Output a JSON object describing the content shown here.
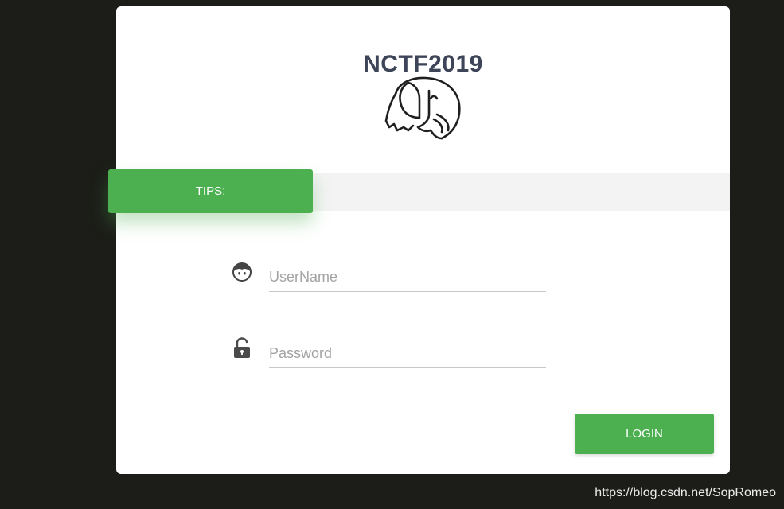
{
  "header": {
    "title": "NCTF2019"
  },
  "logo": {
    "icon": "elephant-icon"
  },
  "tips": {
    "label": "TIPS:"
  },
  "form": {
    "username": {
      "icon": "user-icon",
      "placeholder": "UserName",
      "value": ""
    },
    "password": {
      "icon": "lock-icon",
      "placeholder": "Password",
      "value": ""
    },
    "login_label": "LOGIN"
  },
  "watermark": {
    "text": "https://blog.csdn.net/SopRomeo"
  },
  "colors": {
    "accent": "#4caf50",
    "background": "#1c1d18",
    "title": "#3e4558"
  }
}
